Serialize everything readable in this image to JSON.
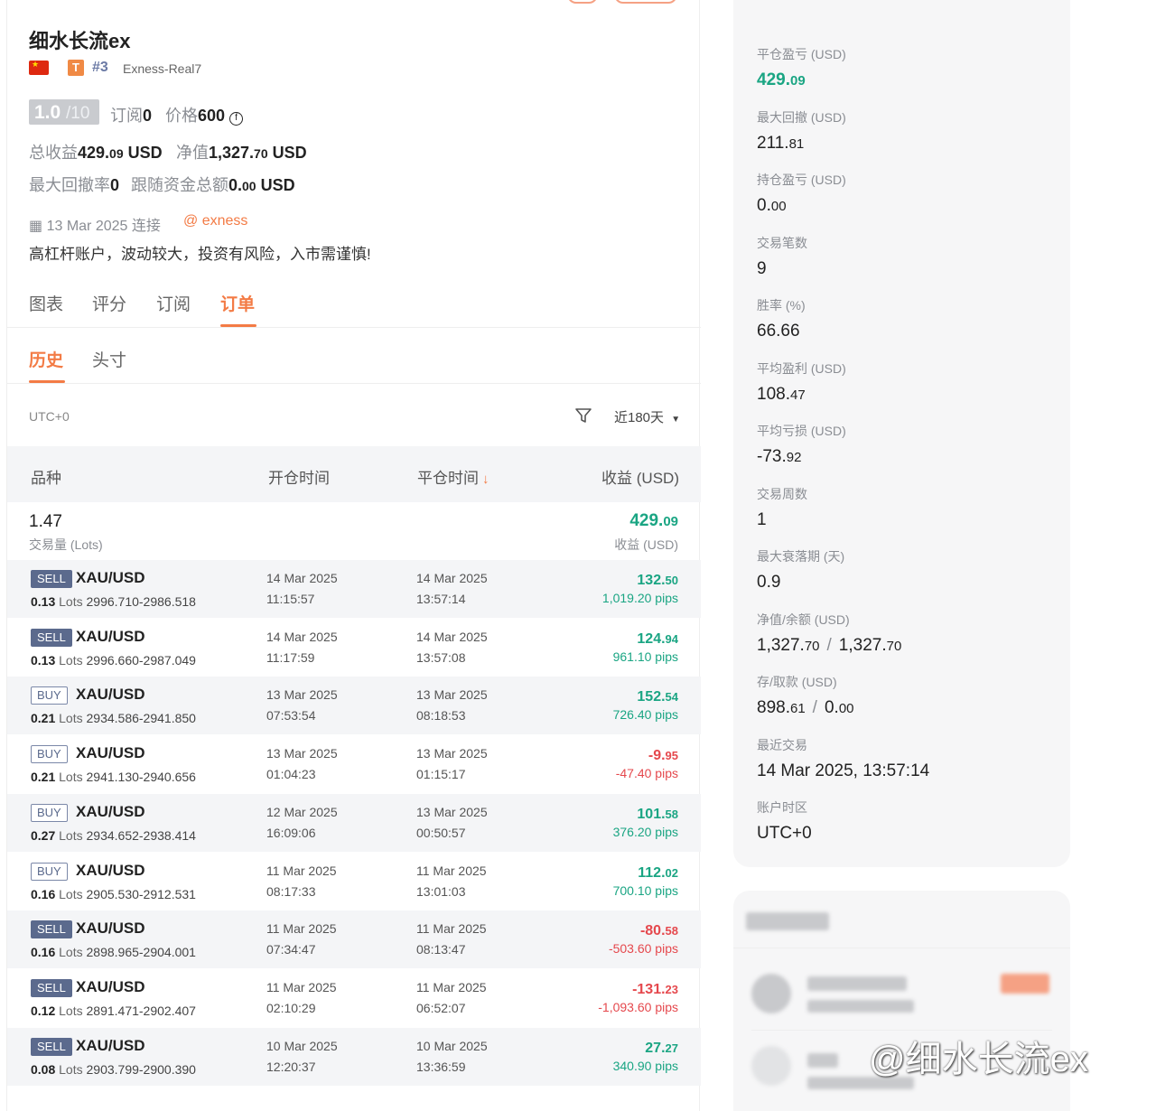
{
  "profile": {
    "name": "细水长流ex",
    "rank": "#3",
    "broker": "Exness-Real7",
    "score": "1.0",
    "score_max": "/10",
    "subs_label": "订阅",
    "subs_value": "0",
    "price_label": "价格",
    "price_value": "600",
    "total_label": "总收益",
    "total_int": "429.",
    "total_dec": "09",
    "total_unit": "USD",
    "equity_label": "净值",
    "equity_int": "1,327.",
    "equity_dec": "70",
    "equity_unit": "USD",
    "dd_label": "最大回撤率",
    "dd_value": "0",
    "follow_label": "跟随资金总额",
    "follow_int": "0.",
    "follow_dec": "00",
    "follow_unit": "USD",
    "connect_date": "13 Mar 2025 连接",
    "connect_via": "@ exness",
    "description": "高杠杆账户，波动较大，投资有风险，入市需谨慎!"
  },
  "tabs": [
    "图表",
    "评分",
    "订阅",
    "订单"
  ],
  "subtabs": [
    "历史",
    "头寸"
  ],
  "filter": {
    "timezone": "UTC+0",
    "range": "近180天"
  },
  "table": {
    "headers": [
      "品种",
      "开仓时间",
      "平仓时间",
      "收益 (USD)"
    ],
    "summary": {
      "lots": "1.47",
      "lots_label": "交易量 (Lots)",
      "pnl_int": "429.",
      "pnl_dec": "09",
      "pnl_label": "收益 (USD)"
    },
    "rows": [
      {
        "side": "SELL",
        "symbol": "XAU/USD",
        "lots": "0.13",
        "unit": "Lots",
        "prices": "2996.710-2986.518",
        "open_date": "14 Mar 2025",
        "open_time": "11:15:57",
        "close_date": "14 Mar 2025",
        "close_time": "13:57:14",
        "pnl_int": "132.",
        "pnl_dec": "50",
        "pips": "1,019.20 pips",
        "sign": "pos"
      },
      {
        "side": "SELL",
        "symbol": "XAU/USD",
        "lots": "0.13",
        "unit": "Lots",
        "prices": "2996.660-2987.049",
        "open_date": "14 Mar 2025",
        "open_time": "11:17:59",
        "close_date": "14 Mar 2025",
        "close_time": "13:57:08",
        "pnl_int": "124.",
        "pnl_dec": "94",
        "pips": "961.10 pips",
        "sign": "pos"
      },
      {
        "side": "BUY",
        "symbol": "XAU/USD",
        "lots": "0.21",
        "unit": "Lots",
        "prices": "2934.586-2941.850",
        "open_date": "13 Mar 2025",
        "open_time": "07:53:54",
        "close_date": "13 Mar 2025",
        "close_time": "08:18:53",
        "pnl_int": "152.",
        "pnl_dec": "54",
        "pips": "726.40 pips",
        "sign": "pos"
      },
      {
        "side": "BUY",
        "symbol": "XAU/USD",
        "lots": "0.21",
        "unit": "Lots",
        "prices": "2941.130-2940.656",
        "open_date": "13 Mar 2025",
        "open_time": "01:04:23",
        "close_date": "13 Mar 2025",
        "close_time": "01:15:17",
        "pnl_int": "-9.",
        "pnl_dec": "95",
        "pips": "-47.40 pips",
        "sign": "neg"
      },
      {
        "side": "BUY",
        "symbol": "XAU/USD",
        "lots": "0.27",
        "unit": "Lots",
        "prices": "2934.652-2938.414",
        "open_date": "12 Mar 2025",
        "open_time": "16:09:06",
        "close_date": "13 Mar 2025",
        "close_time": "00:50:57",
        "pnl_int": "101.",
        "pnl_dec": "58",
        "pips": "376.20 pips",
        "sign": "pos"
      },
      {
        "side": "BUY",
        "symbol": "XAU/USD",
        "lots": "0.16",
        "unit": "Lots",
        "prices": "2905.530-2912.531",
        "open_date": "11 Mar 2025",
        "open_time": "08:17:33",
        "close_date": "11 Mar 2025",
        "close_time": "13:01:03",
        "pnl_int": "112.",
        "pnl_dec": "02",
        "pips": "700.10 pips",
        "sign": "pos"
      },
      {
        "side": "SELL",
        "symbol": "XAU/USD",
        "lots": "0.16",
        "unit": "Lots",
        "prices": "2898.965-2904.001",
        "open_date": "11 Mar 2025",
        "open_time": "07:34:47",
        "close_date": "11 Mar 2025",
        "close_time": "08:13:47",
        "pnl_int": "-80.",
        "pnl_dec": "58",
        "pips": "-503.60 pips",
        "sign": "neg"
      },
      {
        "side": "SELL",
        "symbol": "XAU/USD",
        "lots": "0.12",
        "unit": "Lots",
        "prices": "2891.471-2902.407",
        "open_date": "11 Mar 2025",
        "open_time": "02:10:29",
        "close_date": "11 Mar 2025",
        "close_time": "06:52:07",
        "pnl_int": "-131.",
        "pnl_dec": "23",
        "pips": "-1,093.60 pips",
        "sign": "neg"
      },
      {
        "side": "SELL",
        "symbol": "XAU/USD",
        "lots": "0.08",
        "unit": "Lots",
        "prices": "2903.799-2900.390",
        "open_date": "10 Mar 2025",
        "open_time": "12:20:37",
        "close_date": "10 Mar 2025",
        "close_time": "13:36:59",
        "pnl_int": "27.",
        "pnl_dec": "27",
        "pips": "340.90 pips",
        "sign": "pos"
      }
    ]
  },
  "stats": [
    {
      "label": "平仓盈亏 (USD)",
      "int": "429.",
      "dec": "09",
      "style": "green"
    },
    {
      "label": "最大回撤 (USD)",
      "int": "211.",
      "dec": "81"
    },
    {
      "label": "持仓盈亏 (USD)",
      "int": "0.",
      "dec": "00"
    },
    {
      "label": "交易笔数",
      "int": "9",
      "dec": ""
    },
    {
      "label": "胜率 (%)",
      "int": "66.66",
      "dec": ""
    },
    {
      "label": "平均盈利 (USD)",
      "int": "108.",
      "dec": "47"
    },
    {
      "label": "平均亏损 (USD)",
      "int": "-73.",
      "dec": "92"
    },
    {
      "label": "交易周数",
      "int": "1",
      "dec": ""
    },
    {
      "label": "最大衰落期 (天)",
      "int": "0.9",
      "dec": ""
    },
    {
      "label": "净值/余额 (USD)",
      "int": "1,327.",
      "dec": "70",
      "int2": "1,327.",
      "dec2": "70"
    },
    {
      "label": "存/取款 (USD)",
      "int": "898.",
      "dec": "61",
      "int2": "0.",
      "dec2": "00"
    },
    {
      "label": "最近交易",
      "int": "14 Mar 2025, 13:57:14",
      "dec": ""
    },
    {
      "label": "账户时区",
      "int": "UTC+0",
      "dec": ""
    }
  ],
  "watermark": "@细水长流ex",
  "colors": {
    "accent": "#f37b45",
    "positive": "#1aa583",
    "negative": "#e5484d",
    "sell_badge": "#5b6a8d"
  }
}
